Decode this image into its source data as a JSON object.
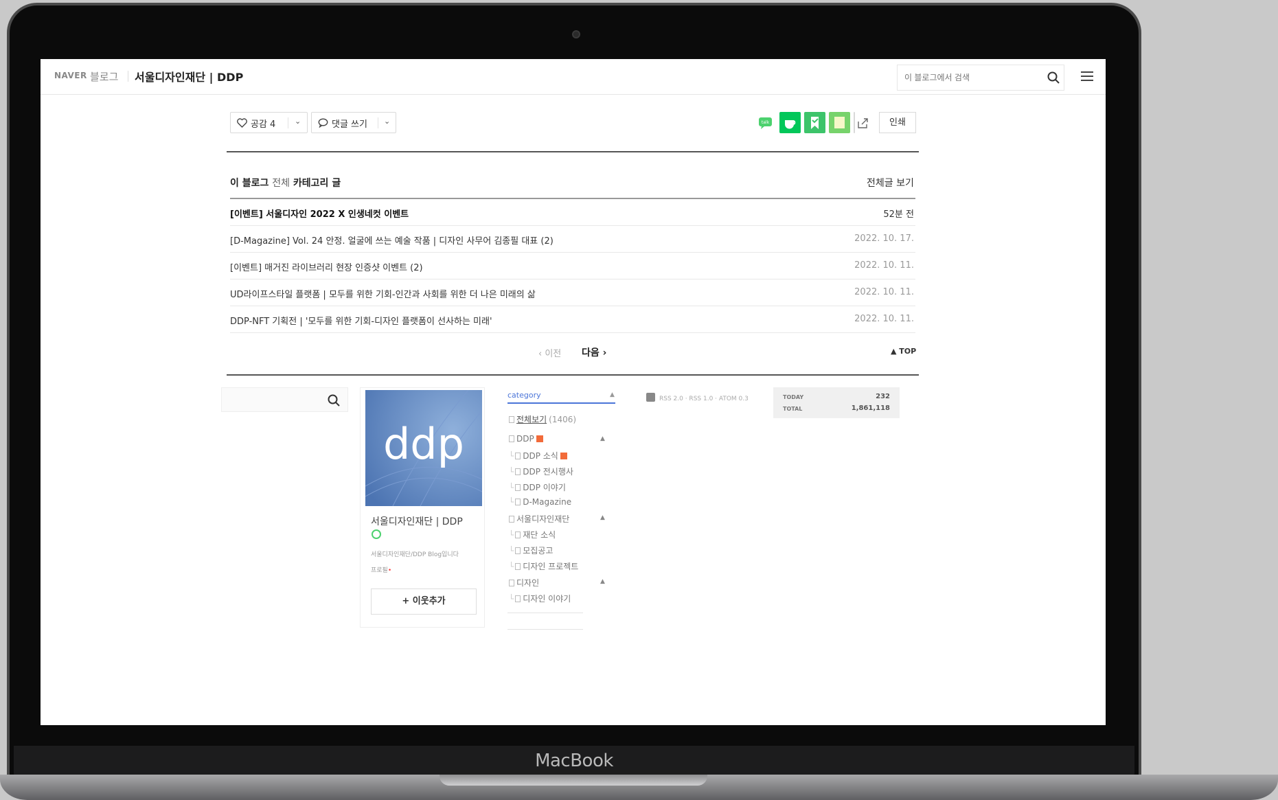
{
  "device": {
    "brand": "MacBook"
  },
  "header": {
    "naver": "NAVER",
    "blog_word": "블로그",
    "blog_title": "서울디자인재단 | DDP",
    "search_placeholder": "이 블로그에서 검색"
  },
  "toolbar": {
    "like_label": "공감 4",
    "comment_label": "댓글 쓰기",
    "print_label": "인쇄",
    "colors": {
      "green": "#03c75a",
      "light_green": "#4cd16e"
    }
  },
  "post_list": {
    "heading_prefix": "이 블로그",
    "heading_mid": "전체",
    "heading_suffix": "카테고리 글",
    "view_all": "전체글 보기",
    "rows": [
      {
        "title": "[이벤트] 서울디자인 2022 X 인생네컷 이벤트",
        "date": "52분 전"
      },
      {
        "title": "[D-Magazine] Vol. 24 안정. 얼굴에 쓰는 예술 작품 | 디자인 사무어 김종필 대표 (2)",
        "date": "2022. 10. 17."
      },
      {
        "title": "[이벤트] 매거진 라이브러리 현장 인증샷 이벤트 (2)",
        "date": "2022. 10. 11."
      },
      {
        "title": "UD라이프스타일 플랫폼 | 모두를 위한 기회-인간과 사회를 위한 더 나은 미래의 삶",
        "date": "2022. 10. 11."
      },
      {
        "title": "DDP-NFT 기획전 | '모두를 위한 기회-디자인 플랫폼이 선사하는 미래'",
        "date": "2022. 10. 11."
      }
    ],
    "prev": "‹ 이전",
    "next": "다음 ›",
    "top": "▲ TOP"
  },
  "profile": {
    "logo_text": "ddp",
    "name": "서울디자인재단 | DDP",
    "desc": "서울디자인재단/DDP Blog입니다",
    "desc_link": "프로필",
    "add_neighbor": "+ 이웃추가"
  },
  "category": {
    "heading": "category",
    "items": [
      {
        "label": "전체보기",
        "count": "(1406)",
        "level": 0
      },
      {
        "label": "DDP",
        "level": 0,
        "new": true
      },
      {
        "label": "DDP 소식",
        "level": 1,
        "new": true
      },
      {
        "label": "DDP 전시행사",
        "level": 1
      },
      {
        "label": "DDP 이야기",
        "level": 1
      },
      {
        "label": "D-Magazine",
        "level": 1
      },
      {
        "label": "서울디자인재단",
        "level": 0
      },
      {
        "label": "재단 소식",
        "level": 1
      },
      {
        "label": "모집공고",
        "level": 1
      },
      {
        "label": "디자인 프로젝트",
        "level": 1
      },
      {
        "label": "디자인",
        "level": 0
      },
      {
        "label": "디자인 이야기",
        "level": 1
      }
    ]
  },
  "rss": {
    "text": "RSS 2.0 · RSS 1.0 · ATOM 0.3"
  },
  "visitors": {
    "today_label": "TODAY",
    "today_value": "232",
    "total_label": "TOTAL",
    "total_value": "1,861,118"
  }
}
